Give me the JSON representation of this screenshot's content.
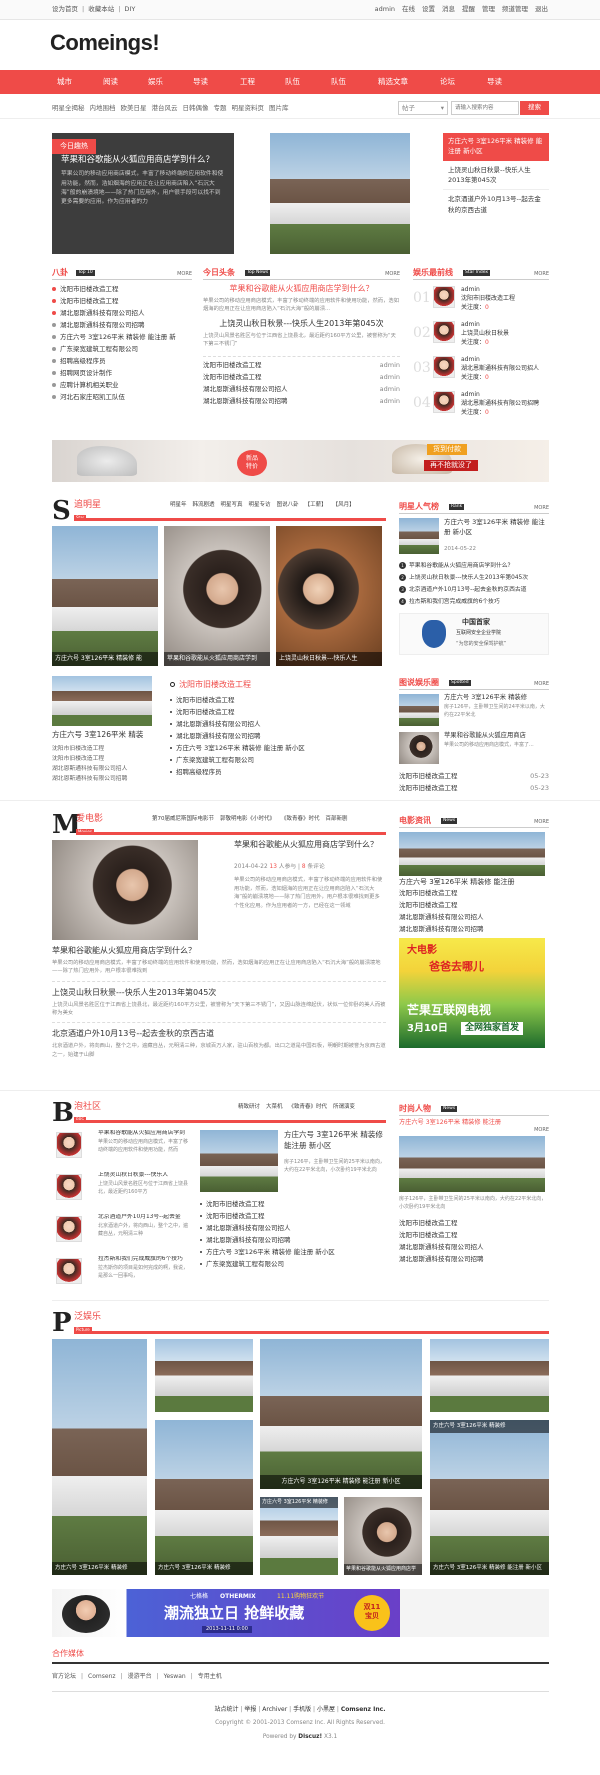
{
  "topbar": {
    "left": [
      "设为首页",
      "收藏本站",
      "DIY"
    ],
    "right": [
      "admin",
      "在线",
      "设置",
      "消息",
      "提醒",
      "管理",
      "频道管理",
      "退出"
    ]
  },
  "logo": "Comeings!",
  "nav": [
    "城市",
    "阅读",
    "娱乐",
    "导读",
    "工程",
    "队伍",
    "队伍",
    "精选文章",
    "论坛",
    "导读"
  ],
  "subnav": [
    "明星全揭秘",
    "内地围档",
    "欧美日星",
    "港台风云",
    "日韩偶像",
    "专题",
    "明星资料页",
    "图片库"
  ],
  "search": {
    "select": "帖子",
    "placeholder": "请输入搜索内容",
    "button": "搜索"
  },
  "feature": {
    "tag": "今日趣热",
    "title": "苹果和谷歌能从火狐应用商店学到什么？",
    "body": "苹果公司的移动应用商店模式，丰富了移动终端的应用软件和使用功能，然而，浩如烟海的应用正在让应用商店陷入“石沉大海”般的崩溃境地——除了热门应用外，用户很手段可以找不到更多需要的应用。作为应用者的力"
  },
  "right_feature": {
    "title": "方庄六号 3室126平米 精装修 能注册 新小区",
    "items": [
      "上饶灵山秋日秋景--快乐人生2013年第045次",
      "北京酒道户外10月13号--起去金秋的京西古道"
    ]
  },
  "bagua": {
    "title": "八卦",
    "badge": "Top 10",
    "more": "MORE",
    "items": [
      "沈阳市旧楼改造工程",
      "沈阳市旧楼改造工程",
      "湖北恩斯通科技有限公司招人",
      "湖北恩斯通科技有限公司招聘",
      "方庄六号 3室126平米 精装修 能注册 新",
      "广东梁宽建筑工程有限公司",
      "招聘高级程序员",
      "招聘网页设计制作",
      "应聘计算机相关职业",
      "河北石家庄昭凯工队伍"
    ]
  },
  "toutiao": {
    "title": "今日头条",
    "badge": "Top News",
    "more": "MORE",
    "headline": "苹果和谷歌能从火狐应用商店学到什么？",
    "desc": "苹果公司的移动应用商店模式，丰富了移动终端的应用软件和使用功能，然而，浩如烟海的应用正在让应用商店陷入“石沉大海”般的崩溃...",
    "headline2": "上饶灵山秋日秋景---快乐人生2013年第045次",
    "desc2": "上饶灵山风景名胜区与位于江西省上饶县北，最近距约160平方公里，被誉称为“天下第三不锈门”",
    "items": [
      {
        "t": "沈阳市旧楼改造工程",
        "u": "admin"
      },
      {
        "t": "沈阳市旧楼改造工程",
        "u": "admin"
      },
      {
        "t": "湖北恩斯通科技有限公司招人",
        "u": "admin"
      },
      {
        "t": "湖北恩斯通科技有限公司招聘",
        "u": "admin"
      }
    ]
  },
  "yule": {
    "title": "娱乐最前线",
    "badge": "Star Index",
    "more": "MORE",
    "items": [
      {
        "n": "01",
        "u": "admin",
        "t": "沈阳市旧楼改造工程",
        "f": "关注度：",
        "v": "0"
      },
      {
        "n": "02",
        "u": "admin",
        "t": "上饶灵山秋日秋景",
        "f": "关注度：",
        "v": "0"
      },
      {
        "n": "03",
        "u": "admin",
        "t": "湖北恩斯通科技有限公司招人",
        "f": "关注度：",
        "v": "0"
      },
      {
        "n": "04",
        "u": "admin",
        "t": "湖北恩斯通科技有限公司招聘",
        "f": "关注度：",
        "v": "0"
      }
    ]
  },
  "banner1": {
    "text1": "新品",
    "text2": "特价",
    "text3": "货到付款",
    "text4": "再不抢就没了"
  },
  "star": {
    "letter": "S",
    "title": "追明星",
    "sub": "Star",
    "tabs": [
      "明星年",
      "韩流剧透",
      "明星写真",
      "明星专访",
      "图说八卦",
      "【工薪】",
      "【风月】"
    ],
    "photos": [
      "方庄六号 3室126平米 精装修 能",
      "苹果和谷歌能从火狐应用商店学到",
      "上饶灵山秋日秋景---快乐人生"
    ],
    "small_title": "方庄六号 3室126平米 精装",
    "small_items": [
      "沈阳市旧楼改造工程",
      "沈阳市旧楼改造工程",
      "湖北恩斯通科技有限公司招人",
      "湖北恩斯通科技有限公司招聘"
    ],
    "list_title": "沈阳市旧楼改造工程",
    "list": [
      "沈阳市旧楼改造工程",
      "沈阳市旧楼改造工程",
      "湖北恩斯通科技有限公司招人",
      "湖北恩斯通科技有限公司招聘",
      "方庄六号 3室126平米 精装修 能注册 新小区",
      "广东梁宽建筑工程有限公司",
      "招聘高级程序员"
    ]
  },
  "renqi": {
    "title": "明星人气榜",
    "badge": "Rank",
    "more": "MORE",
    "top_title": "方庄六号 3室126平米 精装修 能注册 新小区",
    "top_date": "2014-05-22",
    "items": [
      "苹果和谷歌能从火狐应用商店学到什么？",
      "上饶灵山秋日秋景---快乐人生2013年第045次",
      "北京酒道户外10月13号--起去金秋的京西古道",
      "拉杰斯和我们宫完成威旗的6个技巧"
    ],
    "ad_top": "中国首家",
    "ad_mid": "互联网安全企业学院",
    "ad_bot": "“为您的安全保驾护航”"
  },
  "tuji": {
    "title": "图说娱乐圈",
    "badge": "Spotted",
    "more": "MORE",
    "a_title": "方庄六号 3室126平米 精装修",
    "a_desc": "房子126平，主卧带卫生间的24平米以南，大约在22平米北",
    "b_title": "苹果和谷歌能从火狐应用商店",
    "b_desc": "苹果公司的移动应用商店模式，丰富了...",
    "items": [
      {
        "t": "沈阳市旧楼改造工程",
        "d": "05-23"
      },
      {
        "t": "沈阳市旧楼改造工程",
        "d": "05-23"
      }
    ]
  },
  "movie": {
    "letter": "M",
    "title": "爱电影",
    "sub": "Movies",
    "tabs": [
      "第70届威尼斯国际电影节",
      "郭敬明电影《小时代》",
      "《致青春》时代",
      "百部新剧"
    ],
    "headline": "苹果和谷歌能从火狐应用商店学到什么？",
    "meta_date": "2014-04-22",
    "meta_n": "13",
    "meta_mid": " 人参与 | ",
    "meta_c": "8",
    "meta_tail": " 条评论",
    "desc": "苹果公司的移动应用商店模式，丰富了移动终端的应用软件和使用功能，然而，浩如烟海的应用正在让应用商店陷入“石沉大海”般的崩溃境地——除了热门应用外，用户根本很难找到更多个性化应用。作为应用者的一方，已经在这一领域",
    "items": [
      {
        "t": "苹果和谷歌能从火狐应用商店学到什么？",
        "d": "苹果公司的移动应用商店模式，丰富了移动终端的应用软件和使用功能，然而，浩如烟海的应用正在让应用商店陷入“石沉大海”般的崩溃境地——除了热门应用外，用户根本很难找到"
      },
      {
        "t": "上饶灵山秋日秋景---快乐人生2013年第045次",
        "d": "上饶灵山风景名胜区位于江西省上饶县北，最近距约160平方公里，被誉称为“天下第三不锈门”，又因山脉连绵起伏，状似一位仰卧的美人而被称为美女"
      },
      {
        "t": "北京酒道户外10月13号--起去金秋的京西古道",
        "d": "北京酒道户外，将向西山，整个之中，遍藏自丛，元明清三种，京城百万人家，驻山百枚为都。出口之道是中国石板，明朝时期被誉为京西古道之一，始建于山脚"
      }
    ]
  },
  "dianying": {
    "title": "电影资讯",
    "badge": "News",
    "more": "MORE",
    "top_title": "方庄六号 3室126平米 精装修 能注册",
    "items": [
      "沈阳市旧楼改造工程",
      "沈阳市旧楼改造工程",
      "湖北恩斯通科技有限公司招人",
      "湖北恩斯通科技有限公司招聘"
    ],
    "ad_big": "芒果互联网电视",
    "ad_date": "3月10日",
    "ad_tail": "全网独家首发",
    "ad_top": "大电影",
    "ad_top2": "爸爸去哪儿"
  },
  "bbs": {
    "letter": "B",
    "title": "泡社区",
    "sub": "BBS",
    "tabs": [
      "精致研讨",
      "大菜机",
      "《致青春》时代",
      "所谓演变"
    ],
    "posts": [
      {
        "t": "苹果和谷歌能从火狐应用商店学到",
        "d": "苹果公司的移动应用商店模式，丰富了移动终端的应用软件和使用功能，然而"
      },
      {
        "t": "上饶灵山秋日秋景---快乐人",
        "d": "上饶灵山风景名胜区与位于江西省上饶县北，最近距约160平方"
      },
      {
        "t": "北京酒道户外10月13号--起去金",
        "d": "北京酒道户外，将向西山，整个之中，遍藏自丛，元明清三种"
      },
      {
        "t": "拉杰斯和我们完成威旗的6个技巧",
        "d": "拉杰斯你的项目是如何完成的啊，我说，是那么一回事吗，"
      }
    ],
    "mid_title": "方庄六号 3室126平米 精装修 能注册 新小区",
    "mid_desc": "房子126平，主卧带卫生间的25平米以南向，大约在22平米北向，小次卧约19平米北向",
    "list": [
      "沈阳市旧楼改造工程",
      "沈阳市旧楼改造工程",
      "湖北恩斯通科技有限公司招人",
      "湖北恩斯通科技有限公司招聘",
      "方庄六号 3室126平米 精装修 能注册 新小区",
      "广东梁宽建筑工程有限公司"
    ]
  },
  "shishang": {
    "title": "时尚人物",
    "badge": "News",
    "top": "方庄六号 3室126平米 精装修 能注册",
    "more": "MORE",
    "desc": "房子126平，主卧带卫生间的25平米以南向，大约在22平米北向，小次卧约19平米北向",
    "items": [
      "沈阳市旧楼改造工程",
      "沈阳市旧楼改造工程",
      "湖北恩斯通科技有限公司招人",
      "湖北恩斯通科技有限公司招聘"
    ]
  },
  "pic": {
    "letter": "P",
    "title": "泛娱乐",
    "sub": "Picture",
    "caps": [
      "方庄六号 3室126平米 精装修",
      "方庄六号 3室126平米 精装修",
      "方庄六号 3室126平米 精装修",
      "方庄六号 3室126平米 精装修",
      "苹果和谷歌能从火狐应用商店学",
      "方庄六号 3室126平米 精装修 能注册 新小区"
    ],
    "center_cap": "方庄六号 3室126平米 精装修 能注册 新小区"
  },
  "banner2": {
    "left": "七格格",
    "brand": "OTHERMIX",
    "sale": "11.11购物狂欢节",
    "main": "潮流独立日 抢鲜收藏",
    "date": "2013-11-11 0:00",
    "badge1": "双11",
    "badge2": "宝贝"
  },
  "links": {
    "title": "合作媒体",
    "items": [
      "官方论坛",
      "Comsenz",
      "漫游平台",
      "Yeswan",
      "专用主机"
    ]
  },
  "footer": {
    "links": [
      "站点统计",
      "举报",
      "Archiver",
      "手机版",
      "小黑屋"
    ],
    "brand": "Comsenz Inc.",
    "copy": "Copyright © 2001-2013 Comsenz Inc.  All Rights Reserved.",
    "powered": "Powered by ",
    "dz": "Discuz!",
    "ver": " X3.1"
  },
  "colors": {
    "accent": "#ef4b48",
    "dark": "#3d3d3d"
  }
}
